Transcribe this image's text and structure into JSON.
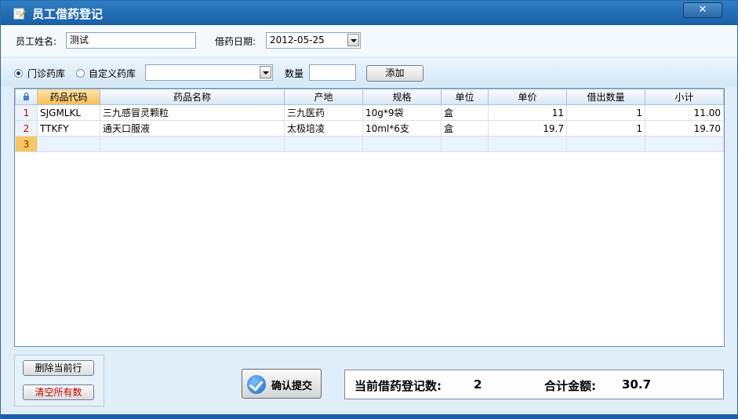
{
  "window": {
    "title": "员工借药登记",
    "close_label": "✕"
  },
  "form": {
    "employee_label": "员工姓名:",
    "employee_value": "测试",
    "date_label": "借药日期:",
    "date_value": "2012-05-25"
  },
  "filter": {
    "radio_outpatient": "门诊药库",
    "radio_custom": "自定义药库",
    "pharmacy_value": "",
    "qty_label": "数量",
    "qty_value": "",
    "add_label": "添加"
  },
  "grid": {
    "columns": [
      "药品代码",
      "药品名称",
      "产地",
      "规格",
      "单位",
      "单价",
      "借出数量",
      "小计"
    ],
    "rows": [
      {
        "no": "1",
        "code": "SJGMLKL",
        "name": "三九感冒灵颗粒",
        "origin": "三九医药",
        "spec": "10g*9袋",
        "unit": "盒",
        "price": "11",
        "qty": "1",
        "subtotal": "11.00"
      },
      {
        "no": "2",
        "code": "TTKFY",
        "name": "通天口服液",
        "origin": "太极培凌",
        "spec": "10ml*6支",
        "unit": "盒",
        "price": "19.7",
        "qty": "1",
        "subtotal": "19.70"
      }
    ],
    "new_row_no": "3"
  },
  "actions": {
    "delete_row": "删除当前行",
    "clear_all": "清空所有数",
    "confirm": "确认提交"
  },
  "summary": {
    "count_label": "当前借药登记数:",
    "count_value": "2",
    "total_label": "合计金额:",
    "total_value": "30.7"
  },
  "colors": {
    "title_bar": "#1a5fa5",
    "accent": "#f7bf58",
    "row_number": "#c00000",
    "clear_text": "#c00000"
  }
}
